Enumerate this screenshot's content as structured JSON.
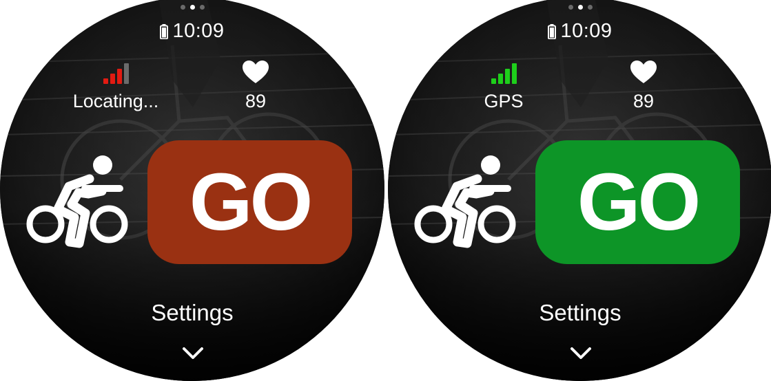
{
  "screens": [
    {
      "status": {
        "time": "10:09",
        "battery_icon": "battery-icon"
      },
      "pager": {
        "count": 3,
        "active": 1
      },
      "gps": {
        "label": "Locating...",
        "icon": "signal-bars-icon",
        "color": "#e21b12",
        "bars_filled": 3,
        "bars_total": 4
      },
      "heart": {
        "value": "89",
        "icon": "heart-icon"
      },
      "activity_icon": "cycling-icon",
      "go": {
        "label": "GO",
        "color": "#9a3112"
      },
      "settings": {
        "label": "Settings"
      },
      "more_icon": "chevron-down-icon"
    },
    {
      "status": {
        "time": "10:09",
        "battery_icon": "battery-icon"
      },
      "pager": {
        "count": 3,
        "active": 1
      },
      "gps": {
        "label": "GPS",
        "icon": "signal-bars-icon",
        "color": "#1ecf1b",
        "bars_filled": 4,
        "bars_total": 4
      },
      "heart": {
        "value": "89",
        "icon": "heart-icon"
      },
      "activity_icon": "cycling-icon",
      "go": {
        "label": "GO",
        "color": "#0d9527"
      },
      "settings": {
        "label": "Settings"
      },
      "more_icon": "chevron-down-icon"
    }
  ]
}
